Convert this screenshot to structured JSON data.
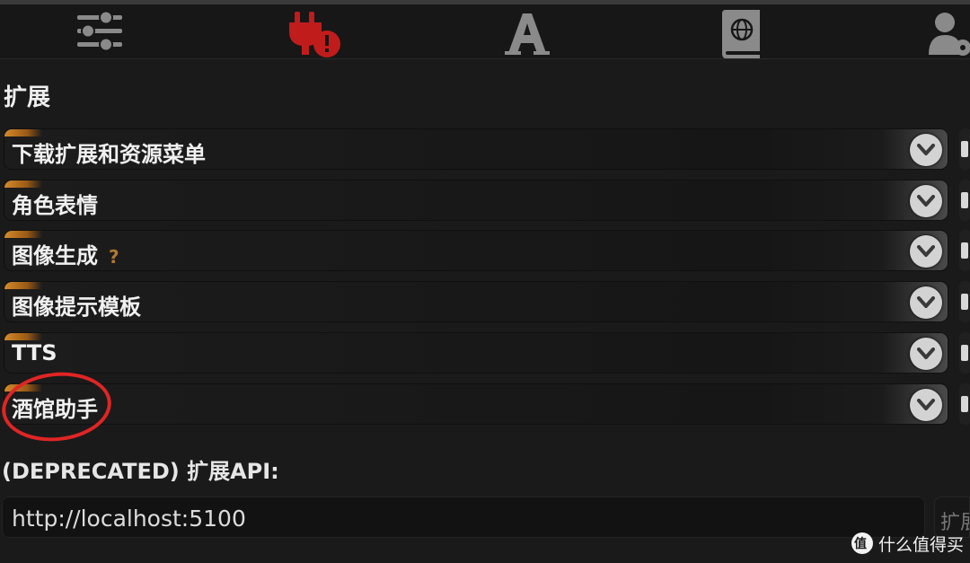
{
  "topbar": {
    "icons": [
      "sliders-icon",
      "plug-alert-icon",
      "font-icon",
      "world-book-icon",
      "user-settings-icon"
    ],
    "active_color": "#c01c1c",
    "icon_color": "#8a8a8a"
  },
  "extensions": {
    "title": "扩展",
    "drawers": [
      {
        "label": "下载扩展和资源菜单",
        "help": ""
      },
      {
        "label": "角色表情",
        "help": ""
      },
      {
        "label": "图像生成",
        "help": "?"
      },
      {
        "label": "图像提示模板",
        "help": ""
      },
      {
        "label": "TTS",
        "help": ""
      },
      {
        "label": "酒馆助手",
        "help": ""
      }
    ]
  },
  "api": {
    "label": "(DEPRECATED) 扩展API:",
    "url_value": "http://localhost:5100",
    "button_label": "扩展"
  },
  "watermark": {
    "text": "什么值得买"
  },
  "colors": {
    "accent_orange": "#d48a2a",
    "highlight_red": "#e02525"
  }
}
